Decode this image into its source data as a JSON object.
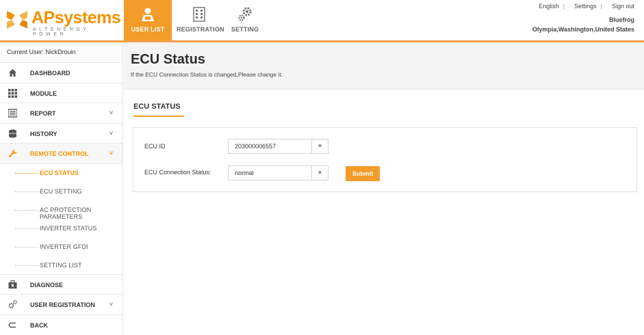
{
  "header": {
    "logo_main": "APsystems",
    "logo_sub": "ALTENERGY POWER",
    "tabs": [
      {
        "label": "USER LIST",
        "icon": "user-icon",
        "active": true
      },
      {
        "label": "REGISTRATION",
        "icon": "building-icon",
        "active": false
      },
      {
        "label": "SETTING",
        "icon": "gears-icon",
        "active": false
      }
    ],
    "links": {
      "language": "English",
      "settings": "Settings",
      "sign_out": "Sign out"
    },
    "user_name": "Bluefrog",
    "user_location": "Olympia,Washington,United States",
    "accent_color": "#f39c29"
  },
  "sidebar": {
    "current_user": "Current User: NickDrouin",
    "items": [
      {
        "label": "DASHBOARD",
        "icon": "home-icon"
      },
      {
        "label": "MODULE",
        "icon": "grid-icon"
      },
      {
        "label": "REPORT",
        "icon": "report-icon",
        "chevron": "˅"
      },
      {
        "label": "HISTORY",
        "icon": "database-icon",
        "chevron": "˅"
      },
      {
        "label": "REMOTE CONTROL",
        "icon": "wrench-icon",
        "chevron": "˅",
        "open": true
      },
      {
        "label": "DIAGNOSE",
        "icon": "toolbox-icon"
      },
      {
        "label": "USER REGISTRATION",
        "icon": "gears-icon",
        "chevron": "˅"
      },
      {
        "label": "BACK",
        "icon": "back-icon"
      }
    ],
    "sub_items": [
      {
        "label": "ECU STATUS",
        "active": true
      },
      {
        "label": "ECU SETTING"
      },
      {
        "label": "AC PROTECTION PARAMETERS"
      },
      {
        "label": "INVERTER STATUS"
      },
      {
        "label": "INVERTER GFDI"
      },
      {
        "label": "SETTING LIST"
      }
    ]
  },
  "main": {
    "title": "ECU Status",
    "subtitle": "If the ECU Connection Status is changed,Please change it.",
    "section_tab": "ECU STATUS",
    "form": {
      "ecu_id_label": "ECU ID",
      "ecu_id_value": "203000006557",
      "status_label": "ECU Connection Status:",
      "status_value": "normal",
      "submit_label": "Submit",
      "dropdown_arrow": "▼"
    }
  }
}
